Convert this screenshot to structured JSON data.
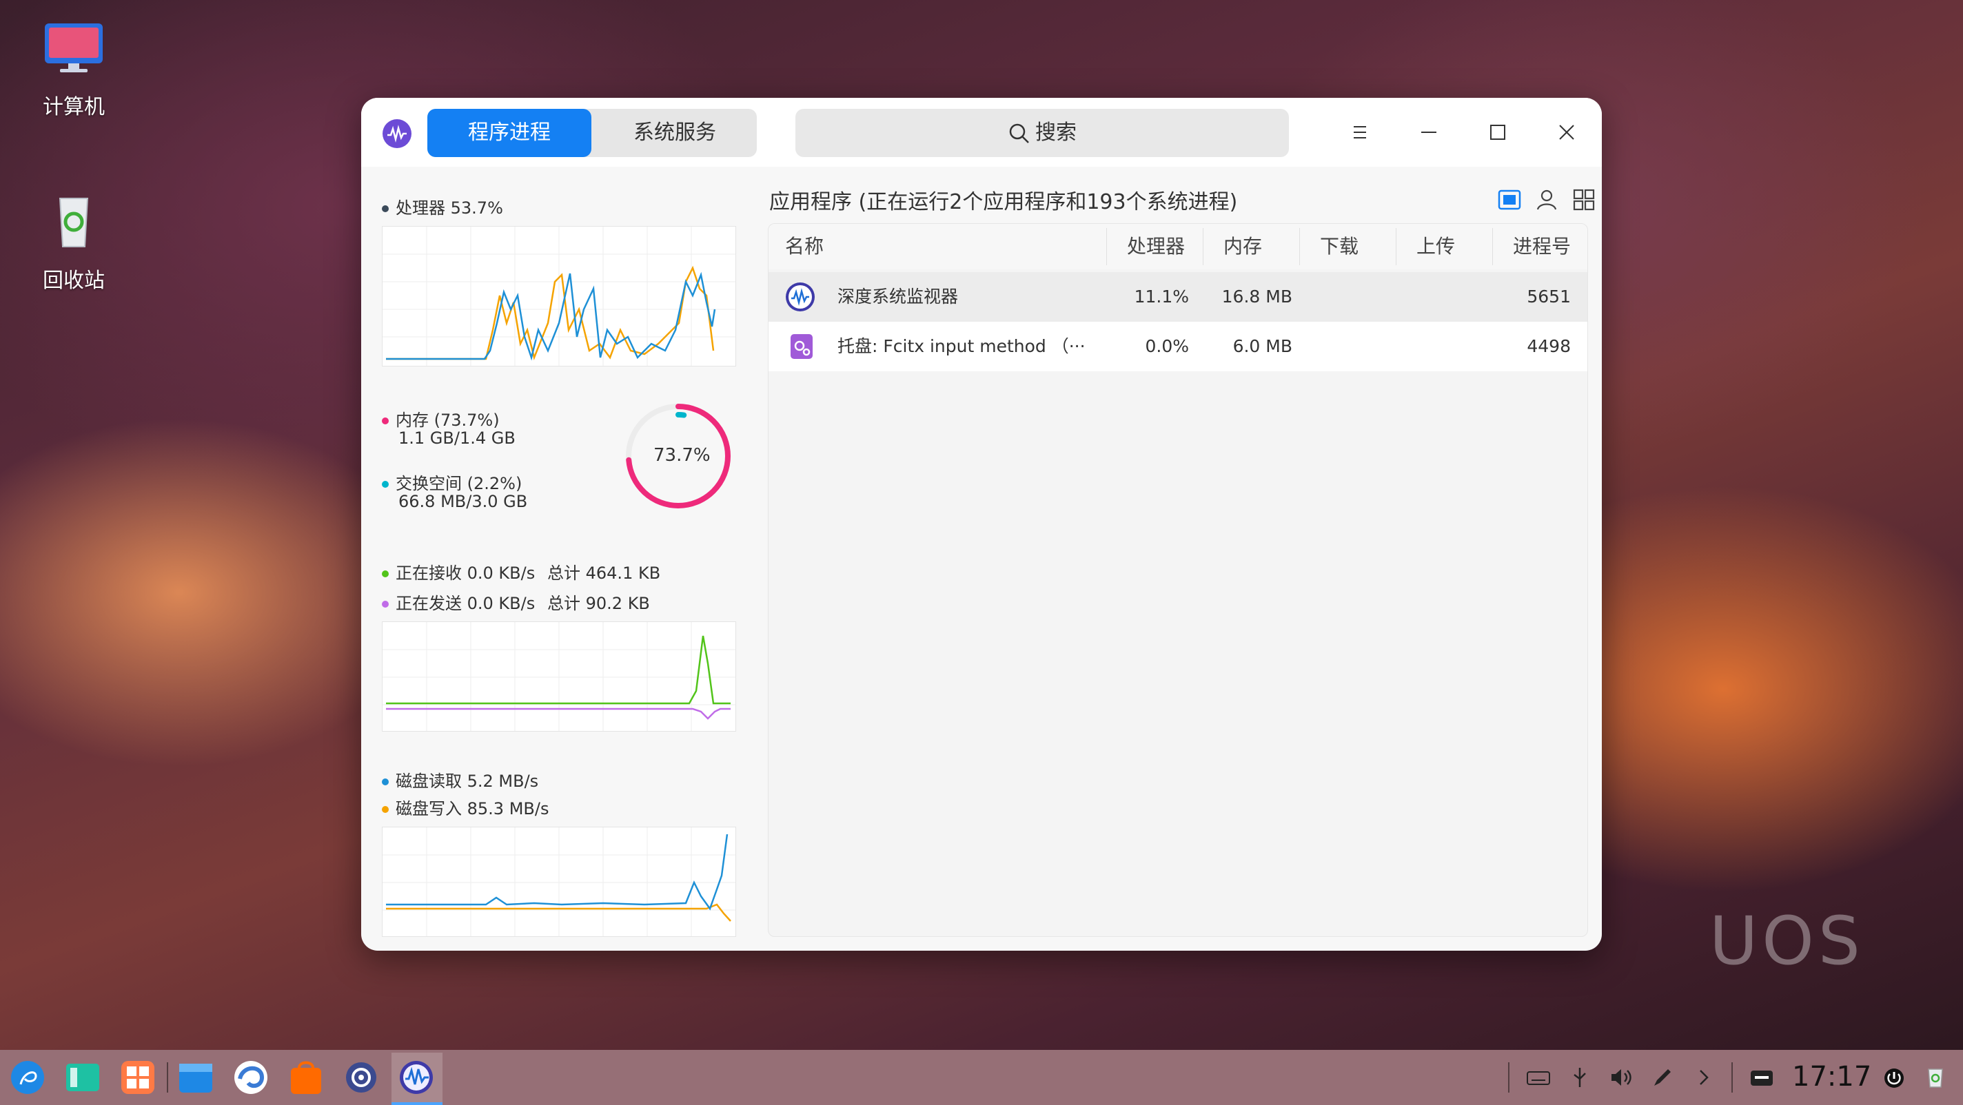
{
  "desktop": {
    "icons": [
      {
        "label": "计算机",
        "icon": "computer-icon"
      },
      {
        "label": "回收站",
        "icon": "trash-icon"
      }
    ],
    "watermark": "UOS"
  },
  "window": {
    "tabs": [
      {
        "label": "程序进程",
        "active": true
      },
      {
        "label": "系统服务",
        "active": false
      }
    ],
    "search_placeholder": "搜索",
    "controls": [
      "menu-icon",
      "minimize-icon",
      "maximize-icon",
      "close-icon"
    ]
  },
  "left_panel": {
    "cpu": {
      "label": "处理器 53.7%",
      "percent": 53.7
    },
    "memory": {
      "label": "内存 (73.7%)",
      "detail": "1.1 GB/1.4 GB",
      "percent": 73.7
    },
    "swap": {
      "label": "交换空间 (2.2%)",
      "detail": "66.8 MB/3.0 GB",
      "percent": 2.2
    },
    "ring_label": "73.7%",
    "network": {
      "recv": "正在接收 0.0 KB/s",
      "recv_total": "总计 464.1 KB",
      "send": "正在发送 0.0 KB/s",
      "send_total": "总计 90.2 KB"
    },
    "disk": {
      "read": "磁盘读取 5.2 MB/s",
      "write": "磁盘写入 85.3 MB/s"
    },
    "colors": {
      "cpu_dot": "#3b4a5a",
      "memory": "#ee2a7b",
      "swap": "#00b5cc",
      "recv": "#52c41a",
      "send": "#c06ce8",
      "disk_read": "#1e90d6",
      "disk_write": "#f5a300"
    }
  },
  "process_list": {
    "title": "应用程序 (正在运行2个应用程序和193个系统进程)",
    "view_icons": [
      "app-view-icon",
      "user-view-icon",
      "all-view-icon"
    ],
    "columns": [
      "名称",
      "处理器",
      "内存",
      "下载",
      "上传",
      "进程号"
    ],
    "rows": [
      {
        "name": "深度系统监视器",
        "cpu": "11.1%",
        "memory": "16.8 MB",
        "download": "",
        "upload": "",
        "pid": "5651",
        "icon": "system-monitor-icon"
      },
      {
        "name": "托盘: Fcitx input method （···",
        "cpu": "0.0%",
        "memory": "6.0 MB",
        "download": "",
        "upload": "",
        "pid": "4498",
        "icon": "fcitx-tray-icon"
      }
    ]
  },
  "taskbar": {
    "apps": [
      "launcher-icon",
      "multitask-view-icon",
      "app-store-icon",
      "file-manager-icon",
      "browser-icon",
      "store-icon",
      "settings-icon",
      "system-monitor-icon"
    ],
    "tray": [
      "keyboard-icon",
      "usb-icon",
      "volume-icon",
      "pen-icon",
      "expand-arrow-icon",
      "input-method-icon",
      "power-icon",
      "trash-icon"
    ],
    "time": "17:17"
  }
}
